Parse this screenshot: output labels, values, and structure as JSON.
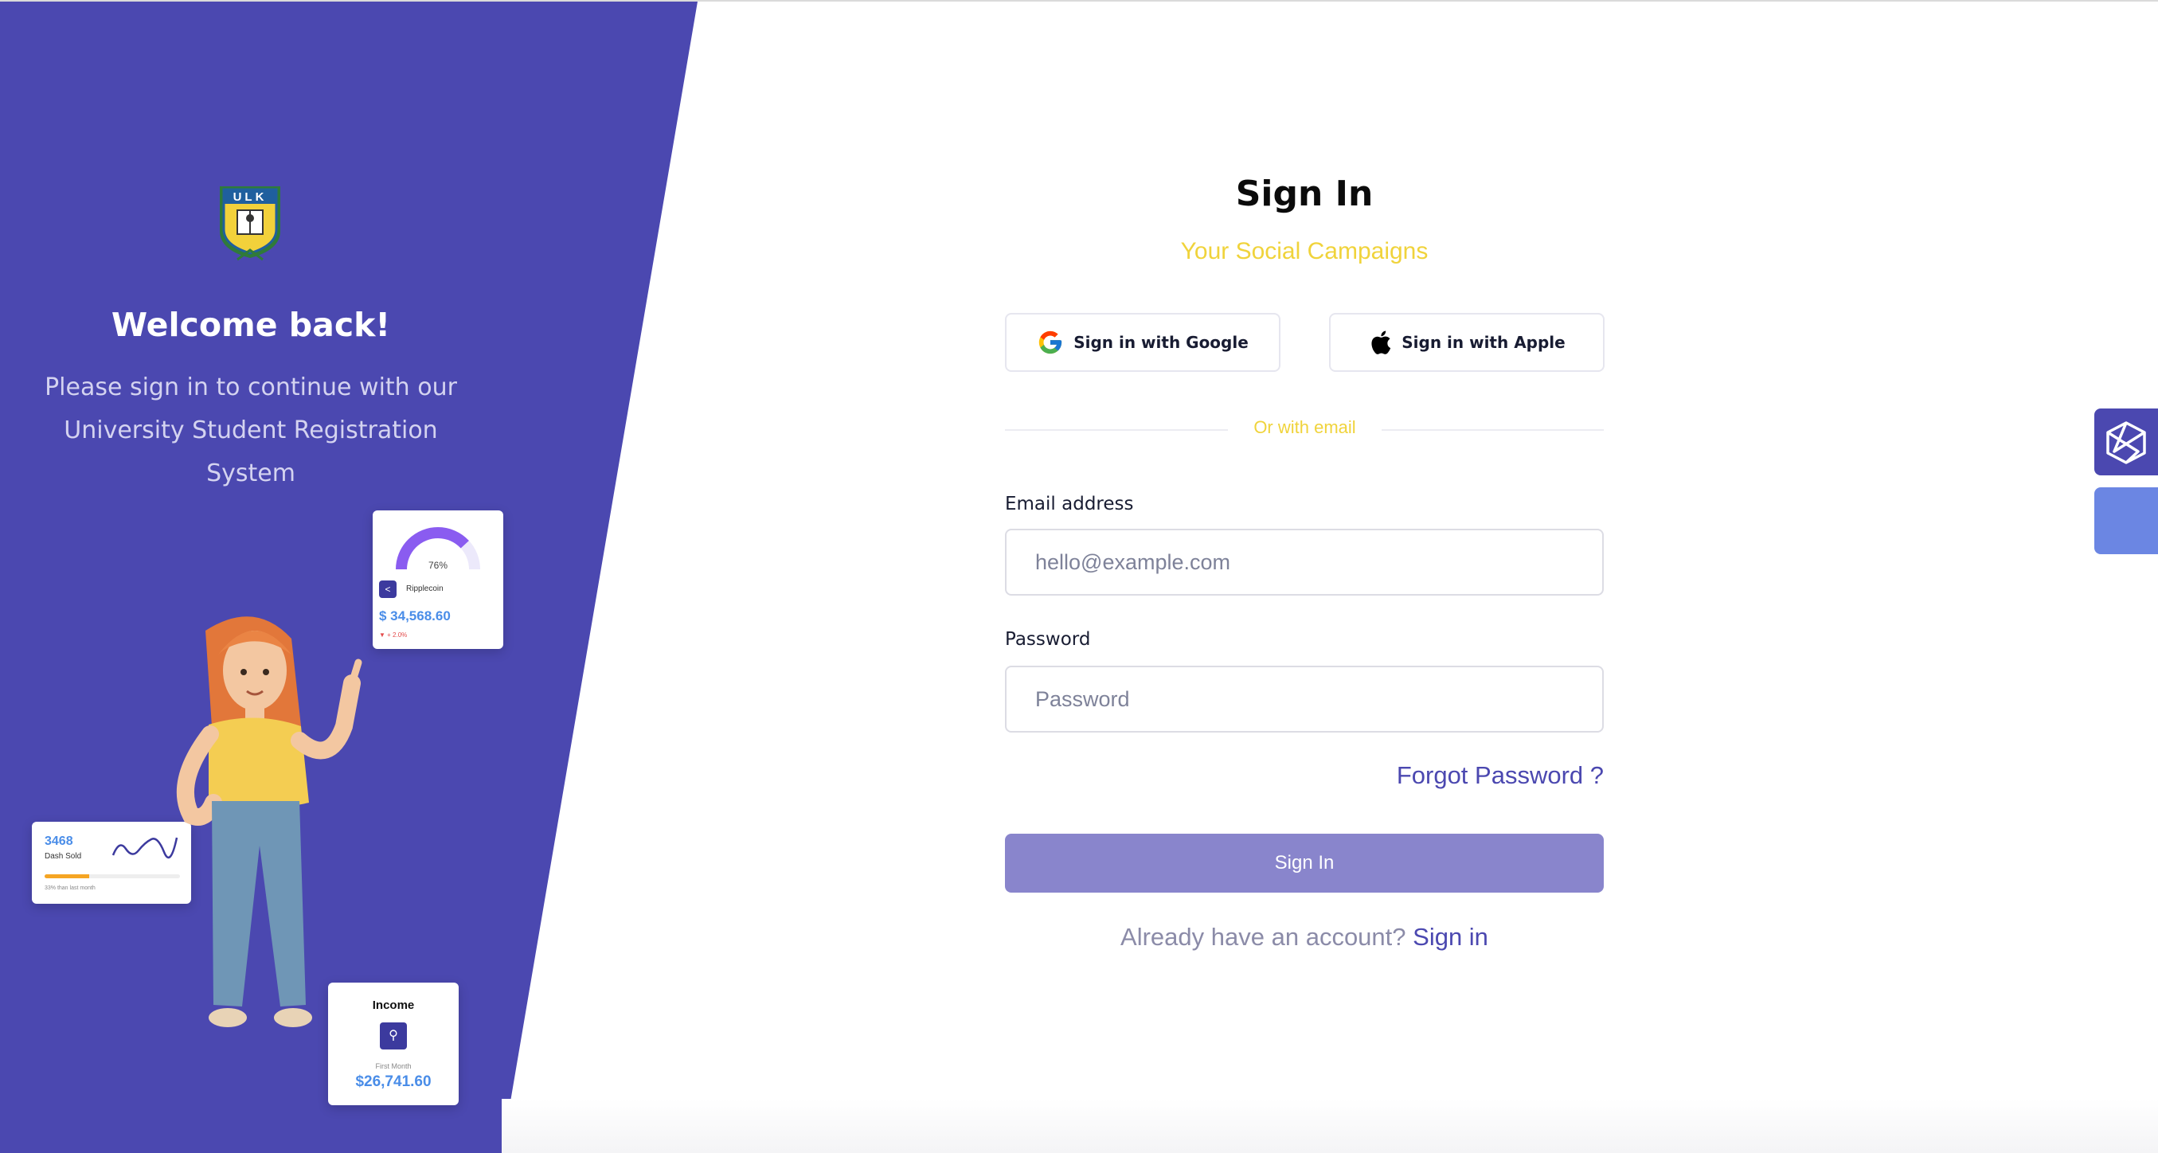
{
  "brand": {
    "logo_text": "ULK"
  },
  "left": {
    "welcome_title": "Welcome back!",
    "welcome_subtitle_line1": "Please sign in to continue with our",
    "welcome_subtitle_line2": "University Student Registration System",
    "background_color": "#4b48b0"
  },
  "cards": {
    "ripple": {
      "percent": "76%",
      "name": "Ripplecoin",
      "value": "$ 34,568.60",
      "change": "▼ + 2.0%"
    },
    "dash": {
      "value": "3468",
      "label": "Dash Sold",
      "note": "33% than last month",
      "progress": 0.33
    },
    "income": {
      "title": "Income",
      "sub": "First Month",
      "value": "$26,741.60"
    }
  },
  "form": {
    "title": "Sign In",
    "subtitle": "Your Social Campaigns",
    "google_label": "Sign in with Google",
    "apple_label": "Sign in with Apple",
    "divider_text": "Or with email",
    "email_label": "Email address",
    "email_placeholder": "hello@example.com",
    "email_value": "",
    "password_label": "Password",
    "password_placeholder": "Password",
    "password_value": "",
    "forgot_label": "Forgot Password ?",
    "submit_label": "Sign In",
    "account_prompt": "Already have an account?",
    "account_link": "Sign in"
  },
  "colors": {
    "accent": "#4b48b0",
    "subtitle_yellow": "#f0d33b",
    "submit_bg": "#8985cc",
    "tab_secondary": "#6b86e3"
  },
  "icons": {
    "google": "google-icon",
    "apple": "apple-icon",
    "side_tab": "cube-icon"
  }
}
